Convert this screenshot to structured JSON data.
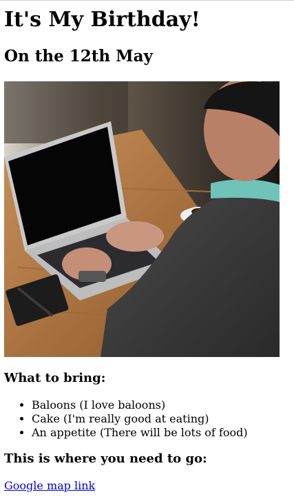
{
  "header": {
    "title": "It's My Birthday!",
    "date": "On the 12th May"
  },
  "hero_image": {
    "description_icon": "photo-laptop-person"
  },
  "bring": {
    "heading": "What to bring:",
    "items": [
      "Baloons (I love baloons)",
      "Cake (I'm really good at eating)",
      "An appetite (There will be lots of food)"
    ]
  },
  "location": {
    "heading": "This is where you need to go:",
    "link_text": "Google map link"
  },
  "colors": {
    "link": "#0000ee",
    "text": "#000000",
    "background": "#ffffff"
  }
}
